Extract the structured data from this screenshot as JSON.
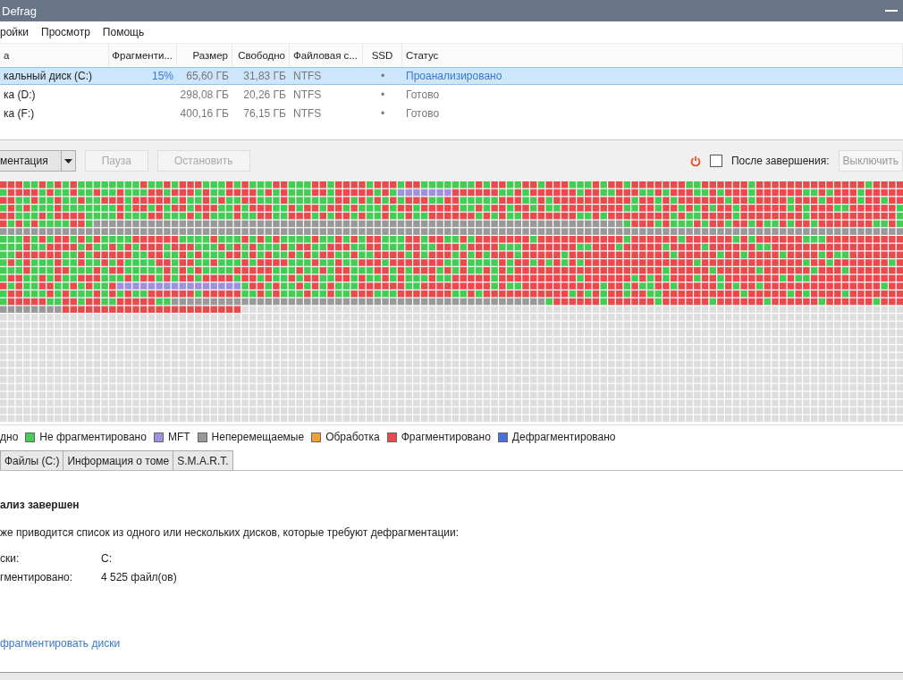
{
  "window": {
    "title": "Defrag"
  },
  "menu": [
    "ройки",
    "Просмотр",
    "Помощь"
  ],
  "disk_table": {
    "columns": [
      "а",
      "Фрагменти...",
      "Размер",
      "Свободно",
      "Файловая с...",
      "SSD",
      "Статус"
    ],
    "rows": [
      {
        "name": "кальный диск (C:)",
        "fragmented": "15%",
        "size": "65,60 ГБ",
        "free": "31,83 ГБ",
        "fs": "NTFS",
        "ssd": "•",
        "status": "Проанализировано",
        "selected": true
      },
      {
        "name": "ка (D:)",
        "fragmented": "",
        "size": "298,08 ГБ",
        "free": "20,26 ГБ",
        "fs": "NTFS",
        "ssd": "•",
        "status": "Готово",
        "selected": false
      },
      {
        "name": "ка (F:)",
        "fragmented": "",
        "size": "400,16 ГБ",
        "free": "76,15 ГБ",
        "fs": "NTFS",
        "ssd": "•",
        "status": "Готово",
        "selected": false
      }
    ]
  },
  "toolbar": {
    "buttons": [
      {
        "label": "ментация",
        "disabled": false
      },
      {
        "label": "Пауза",
        "disabled": true
      },
      {
        "label": "Остановить",
        "disabled": true
      }
    ],
    "after_complete": {
      "label": "После завершения:",
      "checked": false,
      "value": "Выключить",
      "select_disabled": true
    }
  },
  "legend": [
    {
      "label": "дно"
    },
    {
      "label": "Не фрагментировано",
      "color": "#44cc55"
    },
    {
      "label": "MFT",
      "color": "#a090e0"
    },
    {
      "label": "Неперемещаемые",
      "color": "#999999"
    },
    {
      "label": "Обработка",
      "color": "#f5a030"
    },
    {
      "label": "Фрагментировано",
      "color": "#e84a4e"
    },
    {
      "label": "Дефрагментировано",
      "color": "#4a70e0"
    }
  ],
  "tabs": [
    {
      "label": "Файлы (C:)",
      "selected": false
    },
    {
      "label": "Информация о томе",
      "selected": false
    },
    {
      "label": "S.M.A.R.T.",
      "selected": false
    }
  ],
  "report": {
    "title": "ализ завершен",
    "text": "же приводится список из одного или нескольких дисков, которые требуют дефрагментации:",
    "fields": [
      {
        "label": "ски:",
        "value": "C:"
      },
      {
        "label": "гментировано:",
        "value": "4 525 файл(ов)"
      }
    ],
    "link": "фрагментировать диски"
  }
}
